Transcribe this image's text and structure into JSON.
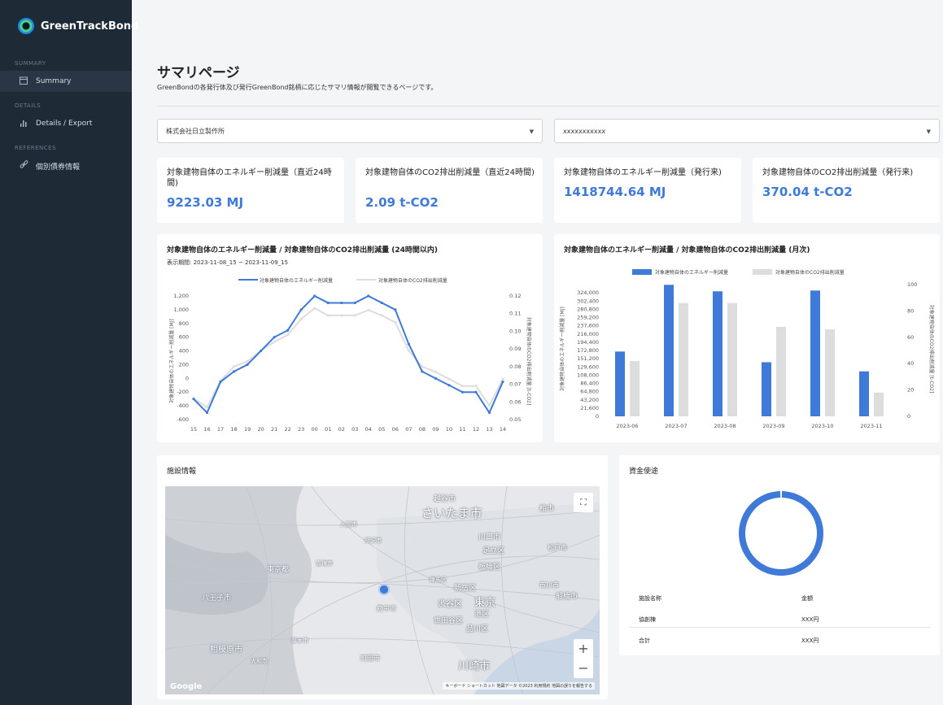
{
  "sidebar": {
    "brand": "GreenTrackBond",
    "sections": [
      {
        "label": "SUMMARY"
      },
      {
        "label": "DETAILS"
      },
      {
        "label": "REFERENCES"
      }
    ],
    "items": [
      {
        "label": "Summary",
        "icon": "calendar-icon"
      },
      {
        "label": "Details / Export",
        "icon": "bar-chart-icon"
      },
      {
        "label": "個別債券情報",
        "icon": "link-icon"
      }
    ]
  },
  "page": {
    "title": "サマリページ",
    "subtitle": "GreenBondの各発行体及び発行GreenBond銘柄に応じたサマリ情報が閲覧できるページです。"
  },
  "filters": {
    "issuer": "株式会社日立製作所",
    "bond": "xxxxxxxxxxx"
  },
  "kpis": [
    {
      "label": "対象建物自体のエネルギー削減量（直近24時間)",
      "value": "9223.03 MJ"
    },
    {
      "label": "対象建物自体のCO2排出削減量（直近24時間)",
      "value": "2.09 t-CO2"
    },
    {
      "label": "対象建物自体のエネルギー削減量（発行来)",
      "value": "1418744.64 MJ"
    },
    {
      "label": "対象建物自体のCO2排出削減量（発行来)",
      "value": "370.04 t-CO2"
    }
  ],
  "chart24": {
    "title": "対象建物自体のエネルギー削減量 / 対象建物自体のCO2排出削減量 (24時間以内)",
    "period": "表示期間: 2023-11-08_15 ~ 2023-11-09_15",
    "legend1": "対象建物自体のエネルギー削減量",
    "legend2": "対象建物自体のCO2排出削減量",
    "ylabel_left": "対象建物自体のエネルギー削減量 [MJ]",
    "ylabel_right": "対象建物自体のCO2排出削減量 [t-CO2]"
  },
  "chartMonthly": {
    "title": "対象建物自体のエネルギー削減量 / 対象建物自体のCO2排出削減量 (月次)",
    "legend1": "対象建物自体のエネルギー削減量",
    "legend2": "対象建物自体のCO2排出削減量",
    "ylabel_left": "対象建物自体のエネルギー削減量 [MJ]",
    "ylabel_right": "対象建物自体のCO2排出削減量 [t-CO2]"
  },
  "chart_data": [
    {
      "type": "line",
      "x": [
        "15",
        "16",
        "17",
        "18",
        "19",
        "20",
        "21",
        "22",
        "23",
        "00",
        "01",
        "02",
        "03",
        "04",
        "05",
        "06",
        "07",
        "08",
        "09",
        "10",
        "11",
        "12",
        "13",
        "14"
      ],
      "series": [
        {
          "name": "対象建物自体のエネルギー削減量",
          "color": "#3f7ad9",
          "axis": "left",
          "values": [
            -300,
            -500,
            -50,
            100,
            200,
            400,
            600,
            700,
            1000,
            1200,
            1100,
            1100,
            1100,
            1200,
            1100,
            1000,
            500,
            100,
            0,
            -100,
            -200,
            -200,
            -500,
            -50
          ]
        },
        {
          "name": "対象建物自体のCO2排出削減量",
          "color": "#dddddd",
          "axis": "right",
          "values": [
            0.062,
            0.057,
            0.072,
            0.08,
            0.083,
            0.089,
            0.094,
            0.098,
            0.107,
            0.113,
            0.109,
            0.109,
            0.109,
            0.112,
            0.109,
            0.105,
            0.089,
            0.08,
            0.077,
            0.073,
            0.069,
            0.069,
            0.058,
            0.073
          ]
        }
      ],
      "ylim_left": [
        -600,
        1200
      ],
      "yticks_left": [
        -600,
        -400,
        -200,
        0,
        200,
        400,
        600,
        800,
        1000,
        1200
      ],
      "ylim_right": [
        0.05,
        0.12
      ],
      "yticks_right": [
        0.05,
        0.06,
        0.07,
        0.08,
        0.09,
        0.1,
        0.11,
        0.12
      ],
      "xlabel": ""
    },
    {
      "type": "bar",
      "categories": [
        "2023-06",
        "2023-07",
        "2023-08",
        "2023-09",
        "2023-10",
        "2023-11"
      ],
      "series": [
        {
          "name": "対象建物自体のエネルギー削減量",
          "color": "#3f7ad9",
          "axis": "left",
          "values": [
            170000,
            345000,
            328000,
            142000,
            330000,
            118000
          ]
        },
        {
          "name": "対象建物自体のCO2排出削減量",
          "color": "#dddddd",
          "axis": "right",
          "values": [
            42,
            86,
            86,
            68,
            66,
            18
          ]
        }
      ],
      "ylim_left": [
        0,
        345600
      ],
      "yticks_left": [
        0,
        21600,
        43200,
        64800,
        86400,
        108000,
        129600,
        151200,
        172800,
        194400,
        216000,
        237600,
        259200,
        280800,
        302400,
        324000
      ],
      "ylim_right": [
        0,
        100
      ],
      "yticks_right": [
        0,
        20,
        40,
        60,
        80,
        100
      ]
    }
  ],
  "facility": {
    "title": "施設情報",
    "map_labels": [
      "さいたま市",
      "越谷市",
      "柏市",
      "川口市",
      "足立区",
      "板橋区",
      "東京都",
      "八王子市",
      "府中市",
      "新宿区",
      "渋谷区",
      "東京",
      "世田谷区",
      "品川区",
      "港区",
      "市川市",
      "船橋市",
      "相模原市",
      "町田市",
      "川崎市",
      "入間市",
      "所沢市",
      "青梅市",
      "練馬区",
      "松戸市",
      "大和市",
      "厚木市"
    ],
    "attribution": "キーボード ショートカット  地図データ ©2023  利用規約  地図の誤りを報告する",
    "google": "Google",
    "zoom_in": "+",
    "zoom_out": "−"
  },
  "funds": {
    "title": "資金使途",
    "col_name": "施設名称",
    "col_amount": "金額",
    "rows": [
      {
        "name": "協創棟",
        "amount": "XXX円"
      }
    ],
    "total_label": "合計",
    "total_amount": "XXX円",
    "chart_data": {
      "type": "pie",
      "slices": [
        {
          "label": "協創棟",
          "value": 1,
          "color": "#3f7ad9"
        }
      ]
    }
  }
}
